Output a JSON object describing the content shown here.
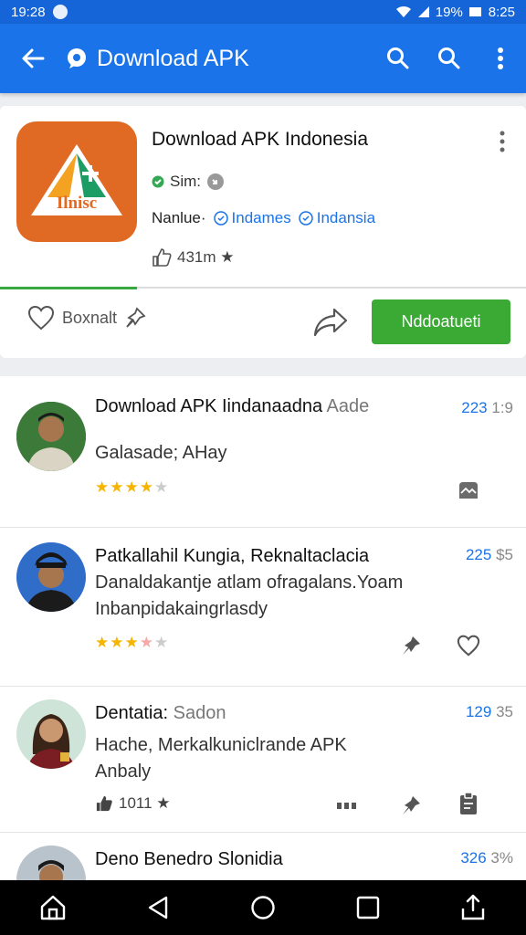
{
  "status_bar": {
    "time": "19:28",
    "battery_percent": "19%",
    "clock_right": "8:25"
  },
  "app_bar": {
    "title": "Download APK",
    "back_icon": "arrow-back-icon",
    "actions": [
      "search-icon",
      "search-icon",
      "more-vert-icon"
    ],
    "color": "#1a73e8"
  },
  "app": {
    "name": "Download APK Indonesia",
    "icon_text": "Ilnisc",
    "size_label": "Sim:",
    "category_label": "Nanlue·",
    "tags": [
      "Indames",
      "Indansia"
    ],
    "rating_text": "431m ★",
    "progress": 0.26,
    "favorite_label": "Boxnalt",
    "download_label": "Nddoatueti",
    "download_color": "#3aaa35"
  },
  "reviews": [
    {
      "name": "Download APK",
      "name_rest": "Iindanaadna",
      "name_muted": "Aade",
      "time_num": "223",
      "time_unit": "1:9",
      "lines": [
        "Galasade; AHay"
      ],
      "rating": 4
    },
    {
      "name": "Patkallahil Kungia, Reknaltaclacia",
      "name_muted": "",
      "time_num": "225",
      "time_unit": "$5",
      "lines": [
        "Danaldakantje atlam ofragalans.Yoam",
        "Inbanpidakaingrlasdy"
      ],
      "rating": 3.5
    },
    {
      "name": "Dentatia:",
      "name_muted": "Sadon",
      "time_num": "129",
      "time_unit": "35",
      "lines": [
        "Hache, Merkalkuniclrande APK",
        "Anbaly"
      ],
      "count_text": "1011 ★"
    },
    {
      "name": "Deno Benedro Slonidia",
      "name_muted": "",
      "time_num": "326",
      "time_unit": "3%"
    }
  ],
  "nav": [
    "home-icon",
    "back-icon",
    "home-circle-icon",
    "recents-icon",
    "share-icon"
  ]
}
